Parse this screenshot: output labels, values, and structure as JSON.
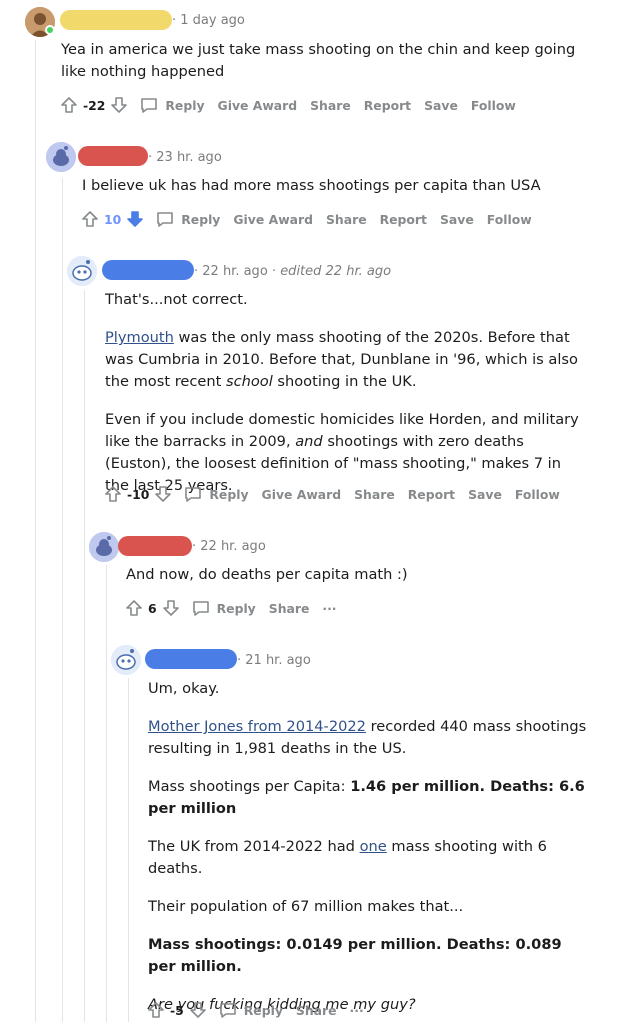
{
  "colors": {
    "yellow_redaction": "#f2d96b",
    "red_redaction": "#d9534f",
    "blue_redaction": "#4a7ee6",
    "link": "#30518a",
    "downvote_active": "#7193ff",
    "meta_gray": "#7c7c7c"
  },
  "comments": [
    {
      "id": "c1",
      "timestamp": "1 day ago",
      "lines": [
        "Yea in america we just take mass shooting on the chin and keep going like nothing happened"
      ],
      "score": "-22",
      "actions": [
        "Reply",
        "Give Award",
        "Share",
        "Report",
        "Save",
        "Follow"
      ]
    },
    {
      "id": "c2",
      "timestamp": "23 hr. ago",
      "lines": [
        "I believe uk has had more mass shootings per capita than USA"
      ],
      "score": "10",
      "actions": [
        "Reply",
        "Give Award",
        "Share",
        "Report",
        "Save",
        "Follow"
      ]
    },
    {
      "id": "c3",
      "timestamp": "22 hr. ago",
      "edited": "edited 22 hr. ago",
      "p1": "That's...not correct.",
      "p2_link": "Plymouth",
      "p2_rest": " was the only mass shooting of the 2020s. Before that was Cumbria in 2010. Before that, Dunblane in '96, which is also the most recent ",
      "p2_italic": "school",
      "p2_end": " shooting in the UK.",
      "p3_a": "Even if you include domestic homicides like Horden, and military like the barracks in 2009, ",
      "p3_italic": "and",
      "p3_b": " shootings with zero deaths (Euston), the loosest definition of \"mass shooting,\" makes 7 in the last 25 years.",
      "score": "-10",
      "actions": [
        "Reply",
        "Give Award",
        "Share",
        "Report",
        "Save",
        "Follow"
      ]
    },
    {
      "id": "c4",
      "timestamp": "22 hr. ago",
      "text": "And now, do deaths per capita math :)",
      "score": "6",
      "actions": [
        "Reply",
        "Share"
      ],
      "more": "···"
    },
    {
      "id": "c5",
      "timestamp": "21 hr. ago",
      "p1": "Um, okay.",
      "p2_link": "Mother Jones from 2014-2022",
      "p2_rest": " recorded 440 mass shootings resulting in 1,981 deaths in the US.",
      "p3_plain": "Mass shootings per Capita: ",
      "p3_bold": "1.46 per million. Deaths: 6.6 per million",
      "p4_a": "The UK from 2014-2022 had ",
      "p4_link": "one",
      "p4_b": " mass shooting with 6 deaths.",
      "p5": "Their population of 67 million makes that...",
      "p6_bold": "Mass shootings: 0.0149 per million. Deaths: 0.089 per million.",
      "p7_italic": "Are you fucking kidding me my guy?",
      "score": "-5",
      "actions": [
        "Reply",
        "Share"
      ],
      "more": "···"
    }
  ]
}
